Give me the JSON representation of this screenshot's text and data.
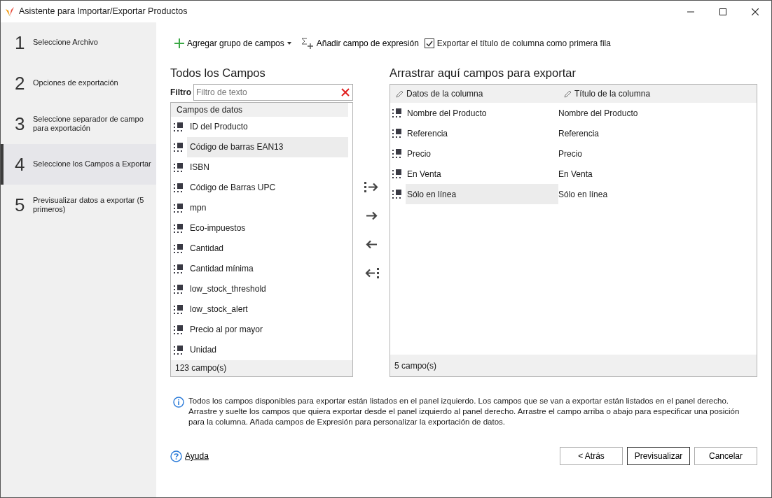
{
  "window": {
    "title": "Asistente para Importar/Exportar Productos"
  },
  "steps": [
    {
      "number": "1",
      "label": "Seleccione Archivo",
      "selected": false
    },
    {
      "number": "2",
      "label": "Opciones de exportación",
      "selected": false
    },
    {
      "number": "3",
      "label": "Seleccione separador de campo para exportación",
      "selected": false
    },
    {
      "number": "4",
      "label": "Seleccione los Campos a Exportar",
      "selected": true
    },
    {
      "number": "5",
      "label": "Previsualizar datos a exportar (5 primeros)",
      "selected": false
    }
  ],
  "toolbar": {
    "add_group": "Agregar grupo de campos",
    "add_expression": "Añadir campo de expresión",
    "export_header": {
      "label": "Exportar el título de columna como primera fila",
      "checked": true
    }
  },
  "left_panel": {
    "title": "Todos los Campos",
    "filter_label": "Filtro",
    "filter": {
      "placeholder": "Filtro de texto"
    },
    "group": "Campos de datos",
    "items": [
      {
        "label": "ID del Producto",
        "selected": false
      },
      {
        "label": "Código de barras EAN13",
        "selected": true
      },
      {
        "label": "ISBN",
        "selected": false
      },
      {
        "label": "Código de Barras UPC",
        "selected": false
      },
      {
        "label": "mpn",
        "selected": false
      },
      {
        "label": "Eco-impuestos",
        "selected": false
      },
      {
        "label": "Cantidad",
        "selected": false
      },
      {
        "label": "Cantidad mínima",
        "selected": false
      },
      {
        "label": "low_stock_threshold",
        "selected": false
      },
      {
        "label": "low_stock_alert",
        "selected": false
      },
      {
        "label": "Precio al por mayor",
        "selected": false
      },
      {
        "label": "Unidad",
        "selected": false
      }
    ],
    "count": "123 campo(s)"
  },
  "transfer_buttons": [
    {
      "kind": "all-right"
    },
    {
      "kind": "right"
    },
    {
      "kind": "left"
    },
    {
      "kind": "all-left"
    }
  ],
  "right_panel": {
    "title": "Arrastrar aquí campos para exportar",
    "columns": [
      "Datos de la columna",
      "Título de la columna"
    ],
    "rows": [
      {
        "data": "Nombre del Producto",
        "title": "Nombre del Producto",
        "selected": false
      },
      {
        "data": "Referencia",
        "title": "Referencia",
        "selected": false
      },
      {
        "data": "Precio",
        "title": "Precio",
        "selected": false
      },
      {
        "data": "En Venta",
        "title": "En Venta",
        "selected": false
      },
      {
        "data": "Sólo en línea",
        "title": "Sólo en línea",
        "selected": true
      }
    ],
    "count": "5 campo(s)"
  },
  "info": "Todos los campos disponibles para exportar están listados en el panel izquierdo. Los campos que se van a exportar están listados en el panel derecho. Arrastre y suelte los campos que quiera exportar desde el panel izquierdo al panel derecho. Arrastre el campo arriba o abajo para especificar una posición para la columna. Añada campos de Expresión para personalizar la exportación de datos.",
  "help": "Ayuda",
  "buttons": [
    {
      "label": "< Atrás",
      "default": false
    },
    {
      "label": "Previsualizar",
      "default": true
    },
    {
      "label": "Cancelar",
      "default": false
    }
  ]
}
